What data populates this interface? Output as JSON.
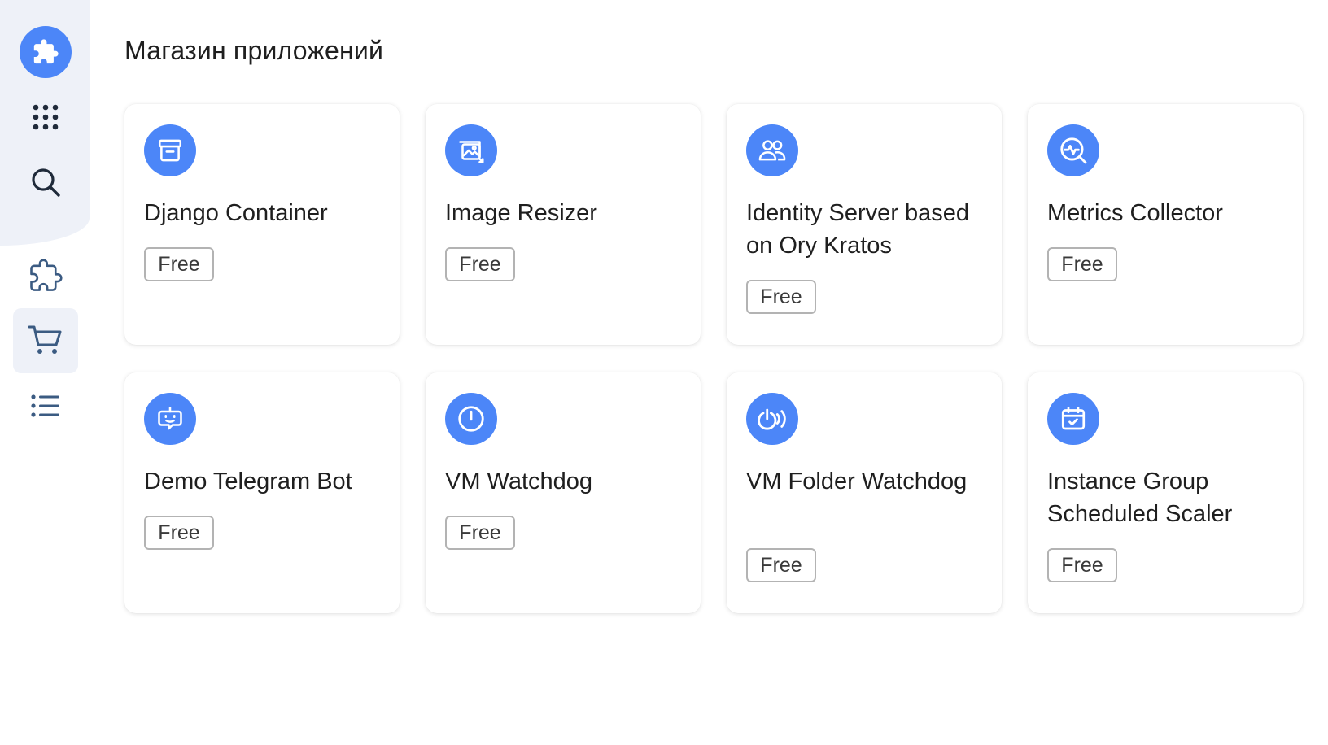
{
  "page": {
    "title": "Магазин приложений"
  },
  "sidebar": {
    "items": [
      {
        "icon": "puzzle-logo-icon",
        "active": false
      },
      {
        "icon": "apps-grid-icon",
        "active": false
      },
      {
        "icon": "search-icon",
        "active": false
      },
      {
        "icon": "puzzle-icon",
        "active": false
      },
      {
        "icon": "cart-icon",
        "active": true
      },
      {
        "icon": "list-icon",
        "active": false
      }
    ]
  },
  "apps": [
    {
      "title": "Django Container",
      "price": "Free",
      "icon": "archive-box-icon"
    },
    {
      "title": "Image Resizer",
      "price": "Free",
      "icon": "image-resize-icon"
    },
    {
      "title": "Identity Server based on Ory Kratos",
      "price": "Free",
      "icon": "users-icon"
    },
    {
      "title": "Metrics Collector",
      "price": "Free",
      "icon": "magnifier-chart-icon"
    },
    {
      "title": "Demo Telegram Bot",
      "price": "Free",
      "icon": "bot-icon"
    },
    {
      "title": "VM Watchdog",
      "price": "Free",
      "icon": "power-icon"
    },
    {
      "title": "VM Folder Watchdog",
      "price": "Free",
      "icon": "power-waves-icon"
    },
    {
      "title": "Instance Group Scheduled Scaler",
      "price": "Free",
      "icon": "calendar-check-icon"
    }
  ],
  "colors": {
    "accent": "#4c86f8",
    "sidebar_bg": "#eef1f8",
    "icon_dark": "#1f2a3a",
    "icon_nav": "#3b5b82"
  }
}
